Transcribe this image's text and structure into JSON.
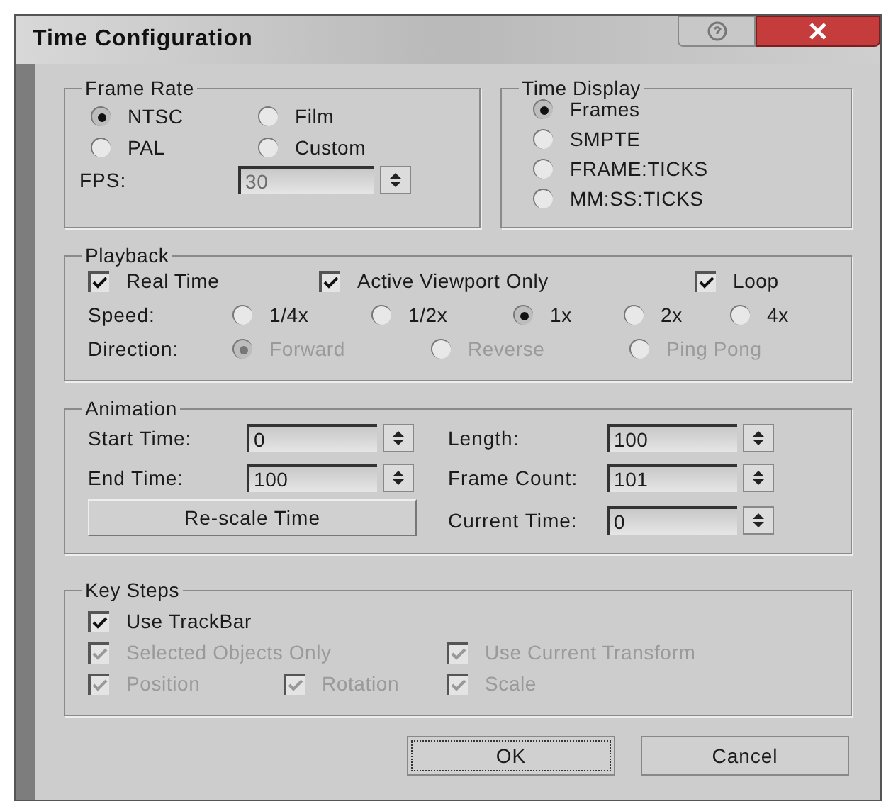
{
  "window": {
    "title": "Time Configuration"
  },
  "frame_rate": {
    "title": "Frame Rate",
    "options": [
      {
        "label": "NTSC",
        "selected": true
      },
      {
        "label": "Film",
        "selected": false
      },
      {
        "label": "PAL",
        "selected": false
      },
      {
        "label": "Custom",
        "selected": false
      }
    ],
    "fps": {
      "label": "FPS:",
      "value": "30",
      "disabled": true
    }
  },
  "time_display": {
    "title": "Time Display",
    "options": [
      {
        "label": "Frames",
        "selected": true
      },
      {
        "label": "SMPTE",
        "selected": false
      },
      {
        "label": "FRAME:TICKS",
        "selected": false
      },
      {
        "label": "MM:SS:TICKS",
        "selected": false
      }
    ]
  },
  "playback": {
    "title": "Playback",
    "checkboxes": [
      {
        "label": "Real Time",
        "checked": true
      },
      {
        "label": "Active Viewport Only",
        "checked": true
      },
      {
        "label": "Loop",
        "checked": true
      }
    ],
    "speed": {
      "label": "Speed:",
      "disabled": false,
      "options": [
        {
          "label": "1/4x",
          "selected": false
        },
        {
          "label": "1/2x",
          "selected": false
        },
        {
          "label": "1x",
          "selected": true
        },
        {
          "label": "2x",
          "selected": false
        },
        {
          "label": "4x",
          "selected": false
        }
      ]
    },
    "direction": {
      "label": "Direction:",
      "disabled": true,
      "options": [
        {
          "label": "Forward",
          "selected": true
        },
        {
          "label": "Reverse",
          "selected": false
        },
        {
          "label": "Ping Pong",
          "selected": false
        }
      ]
    }
  },
  "animation": {
    "title": "Animation",
    "items": [
      {
        "kind": "spinner",
        "label": "Start Time:",
        "value": "0"
      },
      {
        "kind": "spinner",
        "label": "Length:",
        "value": "100"
      },
      {
        "kind": "spinner",
        "label": "End Time:",
        "value": "100"
      },
      {
        "kind": "spinner",
        "label": "Frame Count:",
        "value": "101"
      },
      {
        "kind": "button",
        "label": "Re-scale Time"
      },
      {
        "kind": "spinner",
        "label": "Current Time:",
        "value": "0"
      }
    ]
  },
  "key_steps": {
    "title": "Key Steps",
    "rows": [
      [
        {
          "label": "Use TrackBar",
          "checked": true,
          "disabled": false
        }
      ],
      [
        {
          "label": "Selected Objects Only",
          "checked": true,
          "disabled": true,
          "colspan": 2
        },
        {
          "label": "Use Current Transform",
          "checked": true,
          "disabled": true
        }
      ],
      [
        {
          "label": "Position",
          "checked": true,
          "disabled": true
        },
        {
          "label": "Rotation",
          "checked": true,
          "disabled": true
        },
        {
          "label": "Scale",
          "checked": true,
          "disabled": true
        }
      ]
    ]
  },
  "buttons": [
    {
      "label": "OK",
      "default": true
    },
    {
      "label": "Cancel",
      "default": false
    }
  ]
}
